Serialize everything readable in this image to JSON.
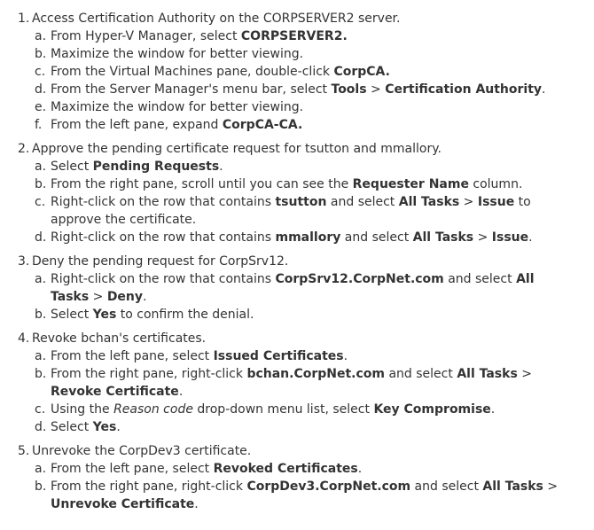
{
  "steps": [
    {
      "num": "1.",
      "text": "Access Certification Authority on the CORPSERVER2 server.",
      "substeps": [
        {
          "letter": "a.",
          "parts": [
            {
              "t": "From Hyper-V Manager, select "
            },
            {
              "t": "CORPSERVER2.",
              "s": "b"
            }
          ]
        },
        {
          "letter": "b.",
          "parts": [
            {
              "t": "Maximize the window for better viewing."
            }
          ]
        },
        {
          "letter": "c.",
          "parts": [
            {
              "t": "From the Virtual Machines pane, double-click "
            },
            {
              "t": "CorpCA.",
              "s": "b"
            }
          ]
        },
        {
          "letter": "d.",
          "parts": [
            {
              "t": "From the Server Manager's menu bar, select "
            },
            {
              "t": "Tools",
              "s": "b"
            },
            {
              "t": " > "
            },
            {
              "t": "Certification Authority",
              "s": "b"
            },
            {
              "t": "."
            }
          ]
        },
        {
          "letter": "e.",
          "parts": [
            {
              "t": "Maximize the window for better viewing."
            }
          ]
        },
        {
          "letter": "f.",
          "parts": [
            {
              "t": "From the left pane, expand "
            },
            {
              "t": "CorpCA-CA.",
              "s": "b"
            }
          ]
        }
      ]
    },
    {
      "num": "2.",
      "text": "Approve the pending certificate request for tsutton and mmallory.",
      "substeps": [
        {
          "letter": "a.",
          "parts": [
            {
              "t": "Select "
            },
            {
              "t": "Pending Requests",
              "s": "b"
            },
            {
              "t": "."
            }
          ]
        },
        {
          "letter": "b.",
          "parts": [
            {
              "t": "From the right pane, scroll until you can see the "
            },
            {
              "t": "Requester Name",
              "s": "b"
            },
            {
              "t": " column."
            }
          ]
        },
        {
          "letter": "c.",
          "parts": [
            {
              "t": "Right-click on the row that contains "
            },
            {
              "t": "tsutton",
              "s": "b"
            },
            {
              "t": " and select "
            },
            {
              "t": "All Tasks",
              "s": "b"
            },
            {
              "t": " > "
            },
            {
              "t": "Issue",
              "s": "b"
            },
            {
              "t": " to approve the certificate."
            }
          ]
        },
        {
          "letter": "d.",
          "parts": [
            {
              "t": "Right-click on the row that contains "
            },
            {
              "t": "mmallory",
              "s": "b"
            },
            {
              "t": " and select "
            },
            {
              "t": "All Tasks",
              "s": "b"
            },
            {
              "t": " > "
            },
            {
              "t": "Issue",
              "s": "b"
            },
            {
              "t": "."
            }
          ]
        }
      ]
    },
    {
      "num": "3.",
      "text": "Deny the pending request for CorpSrv12.",
      "substeps": [
        {
          "letter": "a.",
          "parts": [
            {
              "t": "Right-click on the row that contains "
            },
            {
              "t": "CorpSrv12.CorpNet.com",
              "s": "b"
            },
            {
              "t": " and select "
            },
            {
              "t": "All Tasks",
              "s": "b"
            },
            {
              "t": " > "
            },
            {
              "t": "Deny",
              "s": "b"
            },
            {
              "t": "."
            }
          ]
        },
        {
          "letter": "b.",
          "parts": [
            {
              "t": "Select "
            },
            {
              "t": "Yes",
              "s": "b"
            },
            {
              "t": " to confirm the denial."
            }
          ]
        }
      ]
    },
    {
      "num": "4.",
      "text": "Revoke bchan's certificates.",
      "substeps": [
        {
          "letter": "a.",
          "parts": [
            {
              "t": "From the left pane, select "
            },
            {
              "t": "Issued Certificates",
              "s": "b"
            },
            {
              "t": "."
            }
          ]
        },
        {
          "letter": "b.",
          "parts": [
            {
              "t": "From the right pane, right-click "
            },
            {
              "t": "bchan.CorpNet.com",
              "s": "b"
            },
            {
              "t": " and select "
            },
            {
              "t": "All Tasks",
              "s": "b"
            },
            {
              "t": " > "
            },
            {
              "t": "Revoke Certificate",
              "s": "b"
            },
            {
              "t": "."
            }
          ]
        },
        {
          "letter": "c.",
          "parts": [
            {
              "t": "Using the "
            },
            {
              "t": "Reason code",
              "s": "i"
            },
            {
              "t": " drop-down menu list, select "
            },
            {
              "t": "Key Compromise",
              "s": "b"
            },
            {
              "t": "."
            }
          ]
        },
        {
          "letter": "d.",
          "parts": [
            {
              "t": "Select "
            },
            {
              "t": "Yes",
              "s": "b"
            },
            {
              "t": "."
            }
          ]
        }
      ]
    },
    {
      "num": "5.",
      "text": "Unrevoke the CorpDev3 certificate.",
      "substeps": [
        {
          "letter": "a.",
          "parts": [
            {
              "t": "From the left pane, select "
            },
            {
              "t": "Revoked Certificates",
              "s": "b"
            },
            {
              "t": "."
            }
          ]
        },
        {
          "letter": "b.",
          "parts": [
            {
              "t": "From the right pane, right-click "
            },
            {
              "t": "CorpDev3.CorpNet.com",
              "s": "b"
            },
            {
              "t": " and select "
            },
            {
              "t": "All Tasks",
              "s": "b"
            },
            {
              "t": " > "
            },
            {
              "t": "Unrevoke Certificate",
              "s": "b"
            },
            {
              "t": "."
            }
          ]
        }
      ]
    }
  ]
}
